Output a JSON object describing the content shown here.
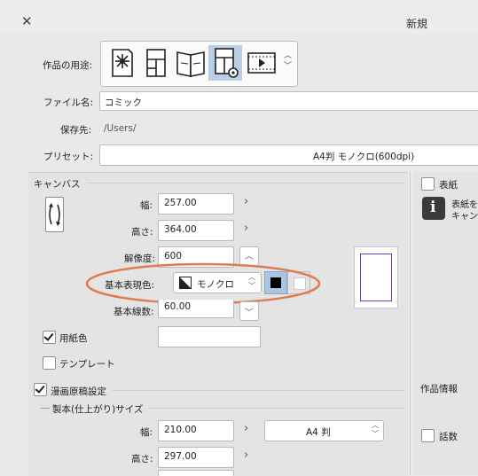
{
  "window": {
    "title": "新規",
    "close_glyph": "✕"
  },
  "form": {
    "usage_label": "作品の用途:",
    "usage_icons": [
      "illustration-icon",
      "comic-icon",
      "book-icon",
      "custom-icon",
      "animation-icon"
    ],
    "selected_usage_index": 3,
    "filename_label": "ファイル名:",
    "filename_value": "コミック",
    "save_label": "保存先:",
    "save_value": "/Users/",
    "preset_label": "プリセット:",
    "preset_value": "A4判 モノクロ(600dpi)"
  },
  "canvas": {
    "section_label": "キャンバス",
    "width_label": "幅:",
    "width_value": "257.00",
    "height_label": "高さ:",
    "height_value": "364.00",
    "resolution_label": "解像度:",
    "resolution_value": "600",
    "color_label": "基本表現色:",
    "color_value": "モノクロ",
    "lines_label": "基本線数:",
    "lines_value": "60.00",
    "paper_color_label": "用紙色",
    "template_label": "テンプレート",
    "manga_label": "漫画原稿設定",
    "finish_label": "製本(仕上がり)サイズ",
    "finish_width_label": "幅:",
    "finish_width_value": "210.00",
    "finish_height_label": "高さ:",
    "finish_height_value": "297.00",
    "paper_size": "A4 判"
  },
  "right": {
    "cover_label": "表紙",
    "cover_info": "表紙を",
    "cover_info2": "キャン",
    "work_info_label": "作品情報",
    "episode_label": "話数"
  },
  "colors": {
    "highlight_ellipse": "#e07a4f",
    "accent": "#b9cfe6"
  }
}
